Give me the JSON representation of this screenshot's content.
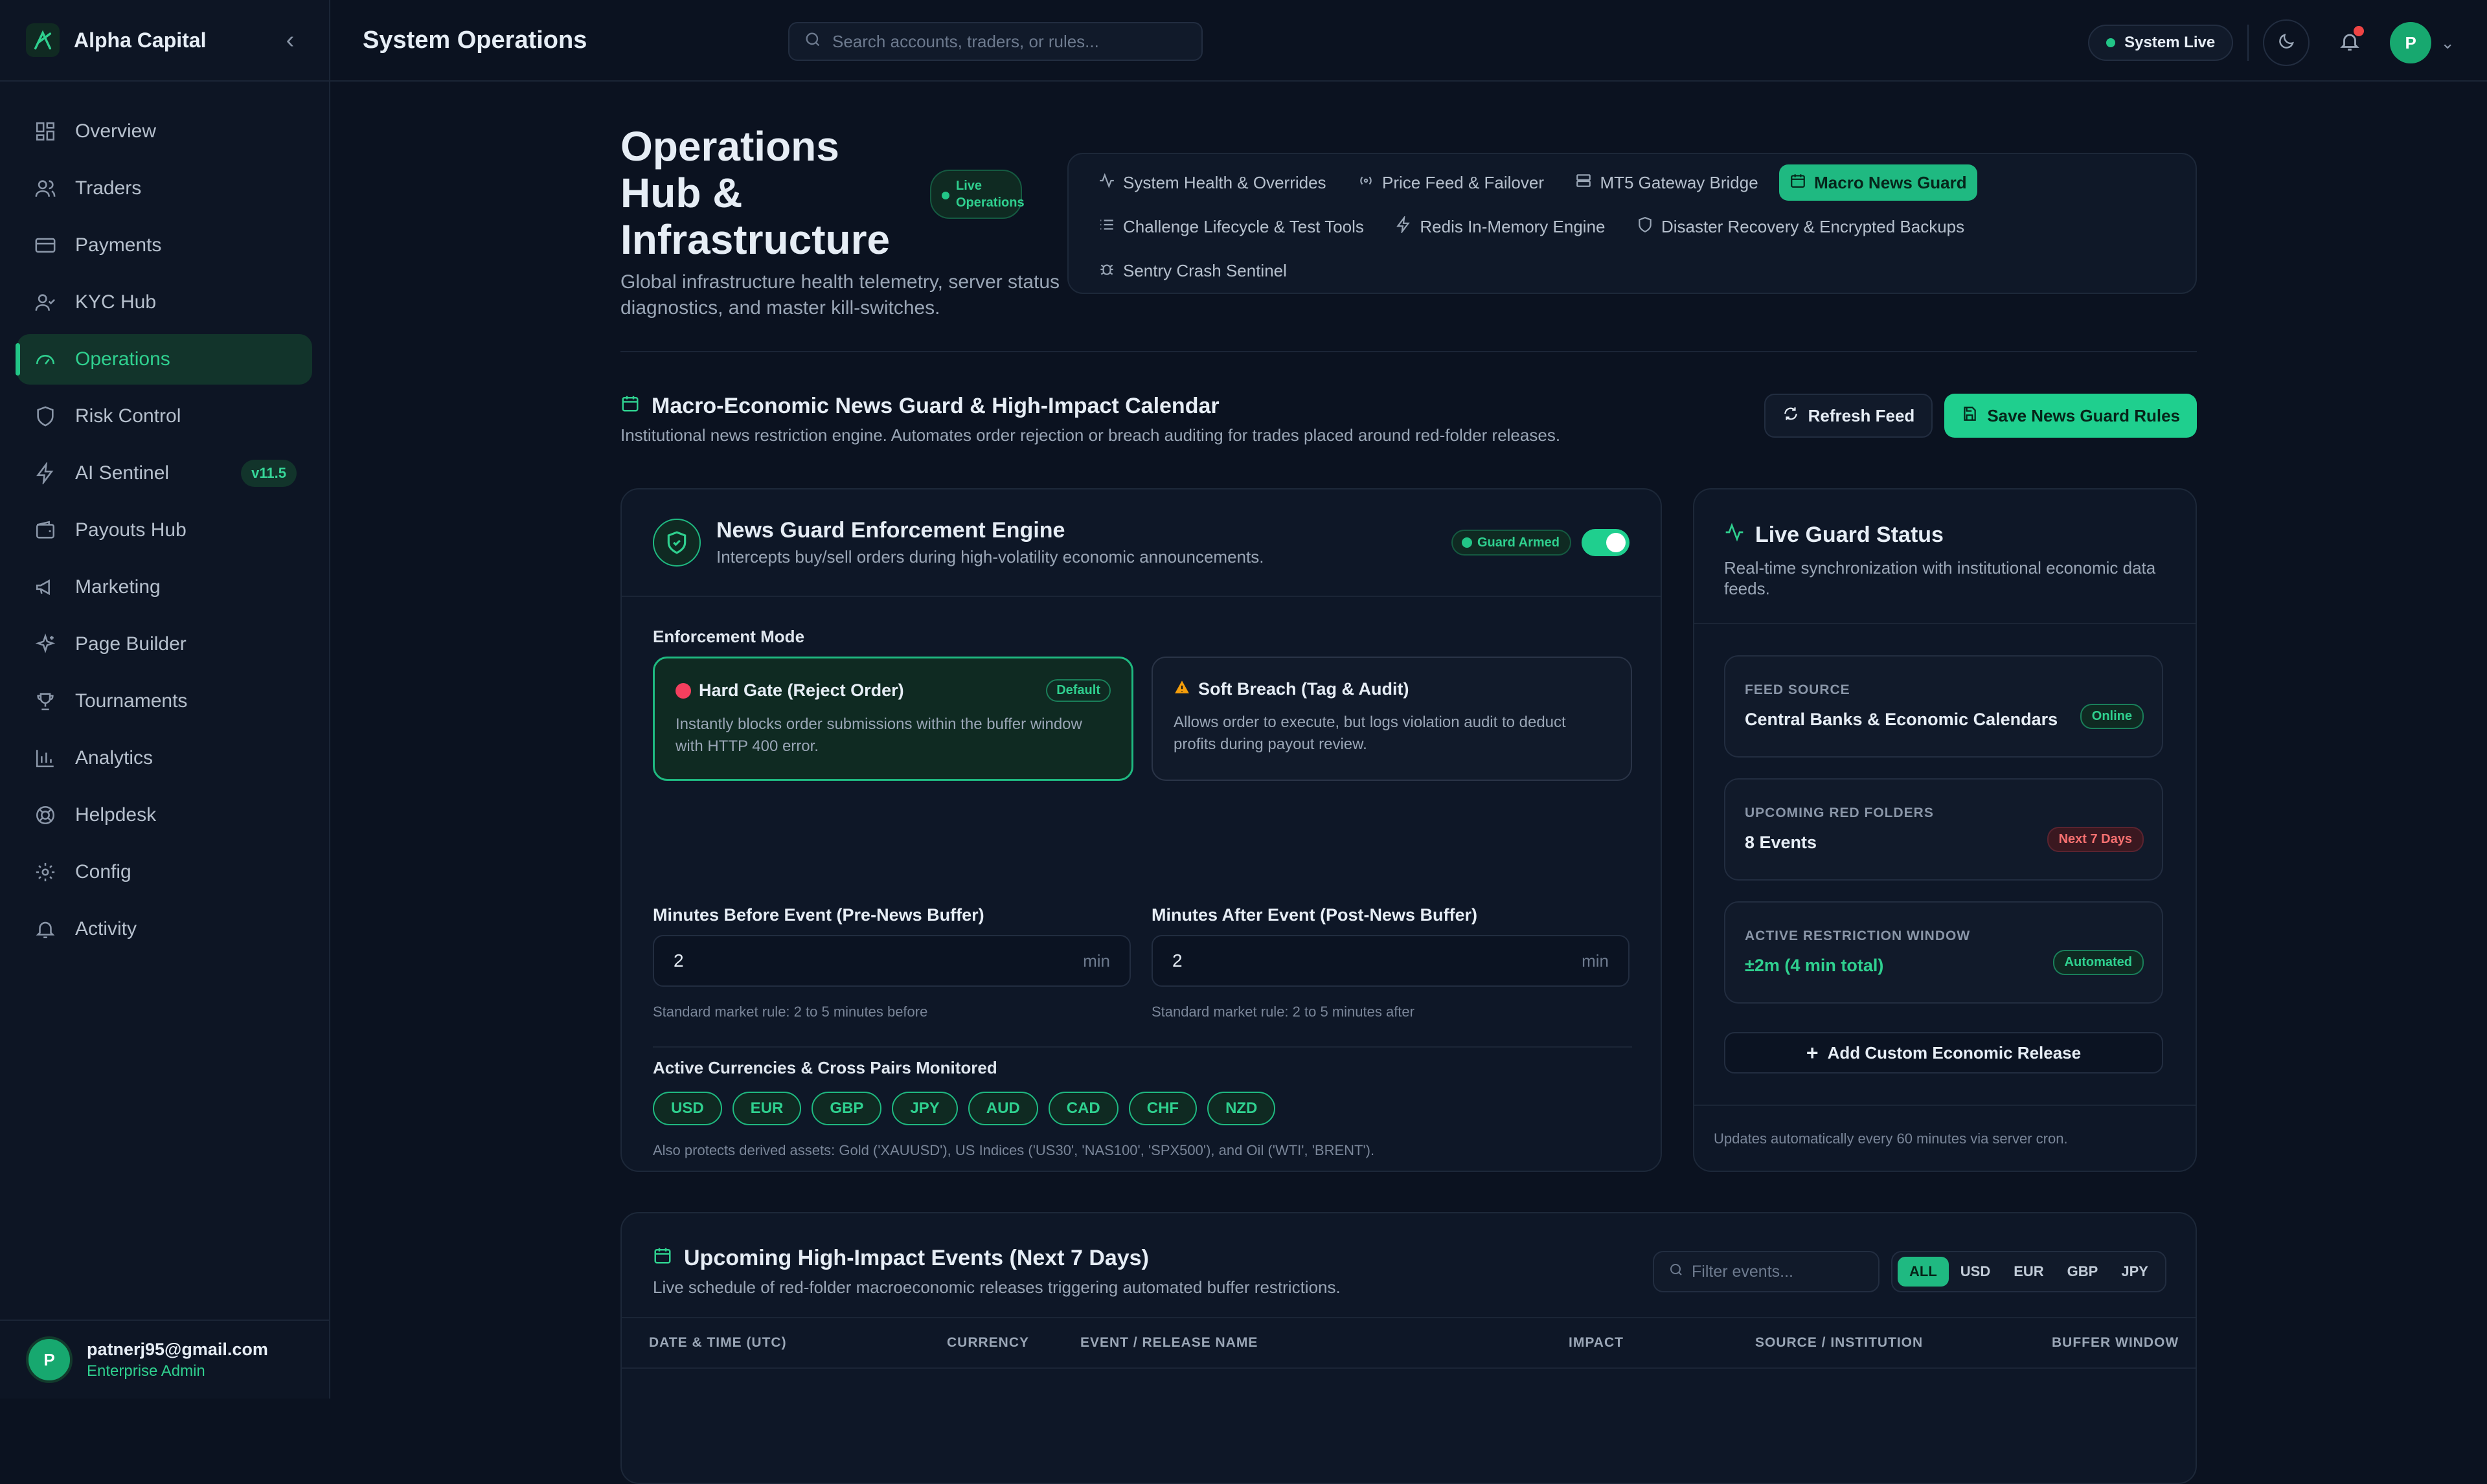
{
  "sidebar": {
    "brand": "Alpha Capital",
    "items": [
      {
        "label": "Overview"
      },
      {
        "label": "Traders"
      },
      {
        "label": "Payments"
      },
      {
        "label": "KYC Hub"
      },
      {
        "label": "Operations"
      },
      {
        "label": "Risk Control"
      },
      {
        "label": "AI Sentinel",
        "badge": "v11.5"
      },
      {
        "label": "Payouts Hub"
      },
      {
        "label": "Marketing"
      },
      {
        "label": "Page Builder"
      },
      {
        "label": "Tournaments"
      },
      {
        "label": "Analytics"
      },
      {
        "label": "Helpdesk"
      },
      {
        "label": "Config"
      },
      {
        "label": "Activity"
      }
    ],
    "active": "Operations",
    "user": {
      "initial": "P",
      "email": "patnerj95@gmail.com",
      "role": "Enterprise Admin"
    }
  },
  "topbar": {
    "title": "System Operations",
    "search_placeholder": "Search accounts, traders, or rules...",
    "status": "System Live",
    "avatar_initial": "P"
  },
  "hub": {
    "title": "Operations Hub & Infrastructure",
    "badge": "Live Operations",
    "subtitle": "Global infrastructure health telemetry, server status diagnostics, and master kill-switches.",
    "tabs": [
      {
        "label": "System Health & Overrides",
        "icon": "activity-icon"
      },
      {
        "label": "Price Feed & Failover",
        "icon": "radio-icon"
      },
      {
        "label": "MT5 Gateway Bridge",
        "icon": "server-icon"
      },
      {
        "label": "Macro News Guard",
        "icon": "calendar-icon"
      },
      {
        "label": "Challenge Lifecycle & Test Tools",
        "icon": "list-icon"
      },
      {
        "label": "Redis In-Memory Engine",
        "icon": "zap-icon"
      },
      {
        "label": "Disaster Recovery & Encrypted Backups",
        "icon": "shield-icon"
      },
      {
        "label": "Sentry Crash Sentinel",
        "icon": "bug-icon"
      }
    ],
    "active_tab": "Macro News Guard"
  },
  "section": {
    "title": "Macro-Economic News Guard & High-Impact Calendar",
    "subtitle": "Institutional news restriction engine. Automates order rejection or breach auditing for trades placed around red-folder releases.",
    "refresh_label": "Refresh Feed",
    "save_label": "Save News Guard Rules"
  },
  "engine": {
    "title": "News Guard Enforcement Engine",
    "subtitle": "Intercepts buy/sell orders during high-volatility economic announcements.",
    "armed_label": "Guard Armed",
    "enabled": true,
    "mode_label": "Enforcement Mode",
    "modes": [
      {
        "title": "Hard Gate (Reject Order)",
        "badge": "Default",
        "desc": "Instantly blocks order submissions within the buffer window with HTTP 400 error.",
        "selected": true
      },
      {
        "title": "Soft Breach (Tag & Audit)",
        "desc": "Allows order to execute, but logs violation audit to deduct profits during payout review.",
        "selected": false
      }
    ],
    "pre": {
      "label": "Minutes Before Event (Pre-News Buffer)",
      "value": "2",
      "unit": "min",
      "hint": "Standard market rule: 2 to 5 minutes before"
    },
    "post": {
      "label": "Minutes After Event (Post-News Buffer)",
      "value": "2",
      "unit": "min",
      "hint": "Standard market rule: 2 to 5 minutes after"
    },
    "currencies_label": "Active Currencies & Cross Pairs Monitored",
    "currencies": [
      "USD",
      "EUR",
      "GBP",
      "JPY",
      "AUD",
      "CAD",
      "CHF",
      "NZD"
    ],
    "also_note": "Also protects derived assets: Gold ('XAUUSD'), US Indices ('US30', 'NAS100', 'SPX500'), and Oil ('WTI', 'BRENT')."
  },
  "status": {
    "title": "Live Guard Status",
    "subtitle": "Real-time synchronization with institutional economic data feeds.",
    "boxes": [
      {
        "key": "FEED SOURCE",
        "value": "Central Banks & Economic Calendars",
        "tag": "Online"
      },
      {
        "key": "UPCOMING RED FOLDERS",
        "value": "8 Events",
        "tag": "Next 7 Days"
      },
      {
        "key": "ACTIVE RESTRICTION WINDOW",
        "value": "±2m (4 min total)",
        "tag": "Automated"
      }
    ],
    "add_label": "Add Custom Economic Release",
    "footer": "Updates automatically every 60 minutes via server cron."
  },
  "events": {
    "title": "Upcoming High-Impact Events (Next 7 Days)",
    "subtitle": "Live schedule of red-folder macroeconomic releases triggering automated buffer restrictions.",
    "filter_placeholder": "Filter events...",
    "currency_filters": [
      "ALL",
      "USD",
      "EUR",
      "GBP",
      "JPY"
    ],
    "active_filter": "ALL",
    "columns": [
      "DATE & TIME (UTC)",
      "CURRENCY",
      "EVENT / RELEASE NAME",
      "IMPACT",
      "SOURCE / INSTITUTION",
      "BUFFER WINDOW"
    ]
  },
  "colors": {
    "accent": "#1fcf8e",
    "background": "#0b1220",
    "danger": "#f43f5e",
    "warning": "#f59e0b"
  }
}
